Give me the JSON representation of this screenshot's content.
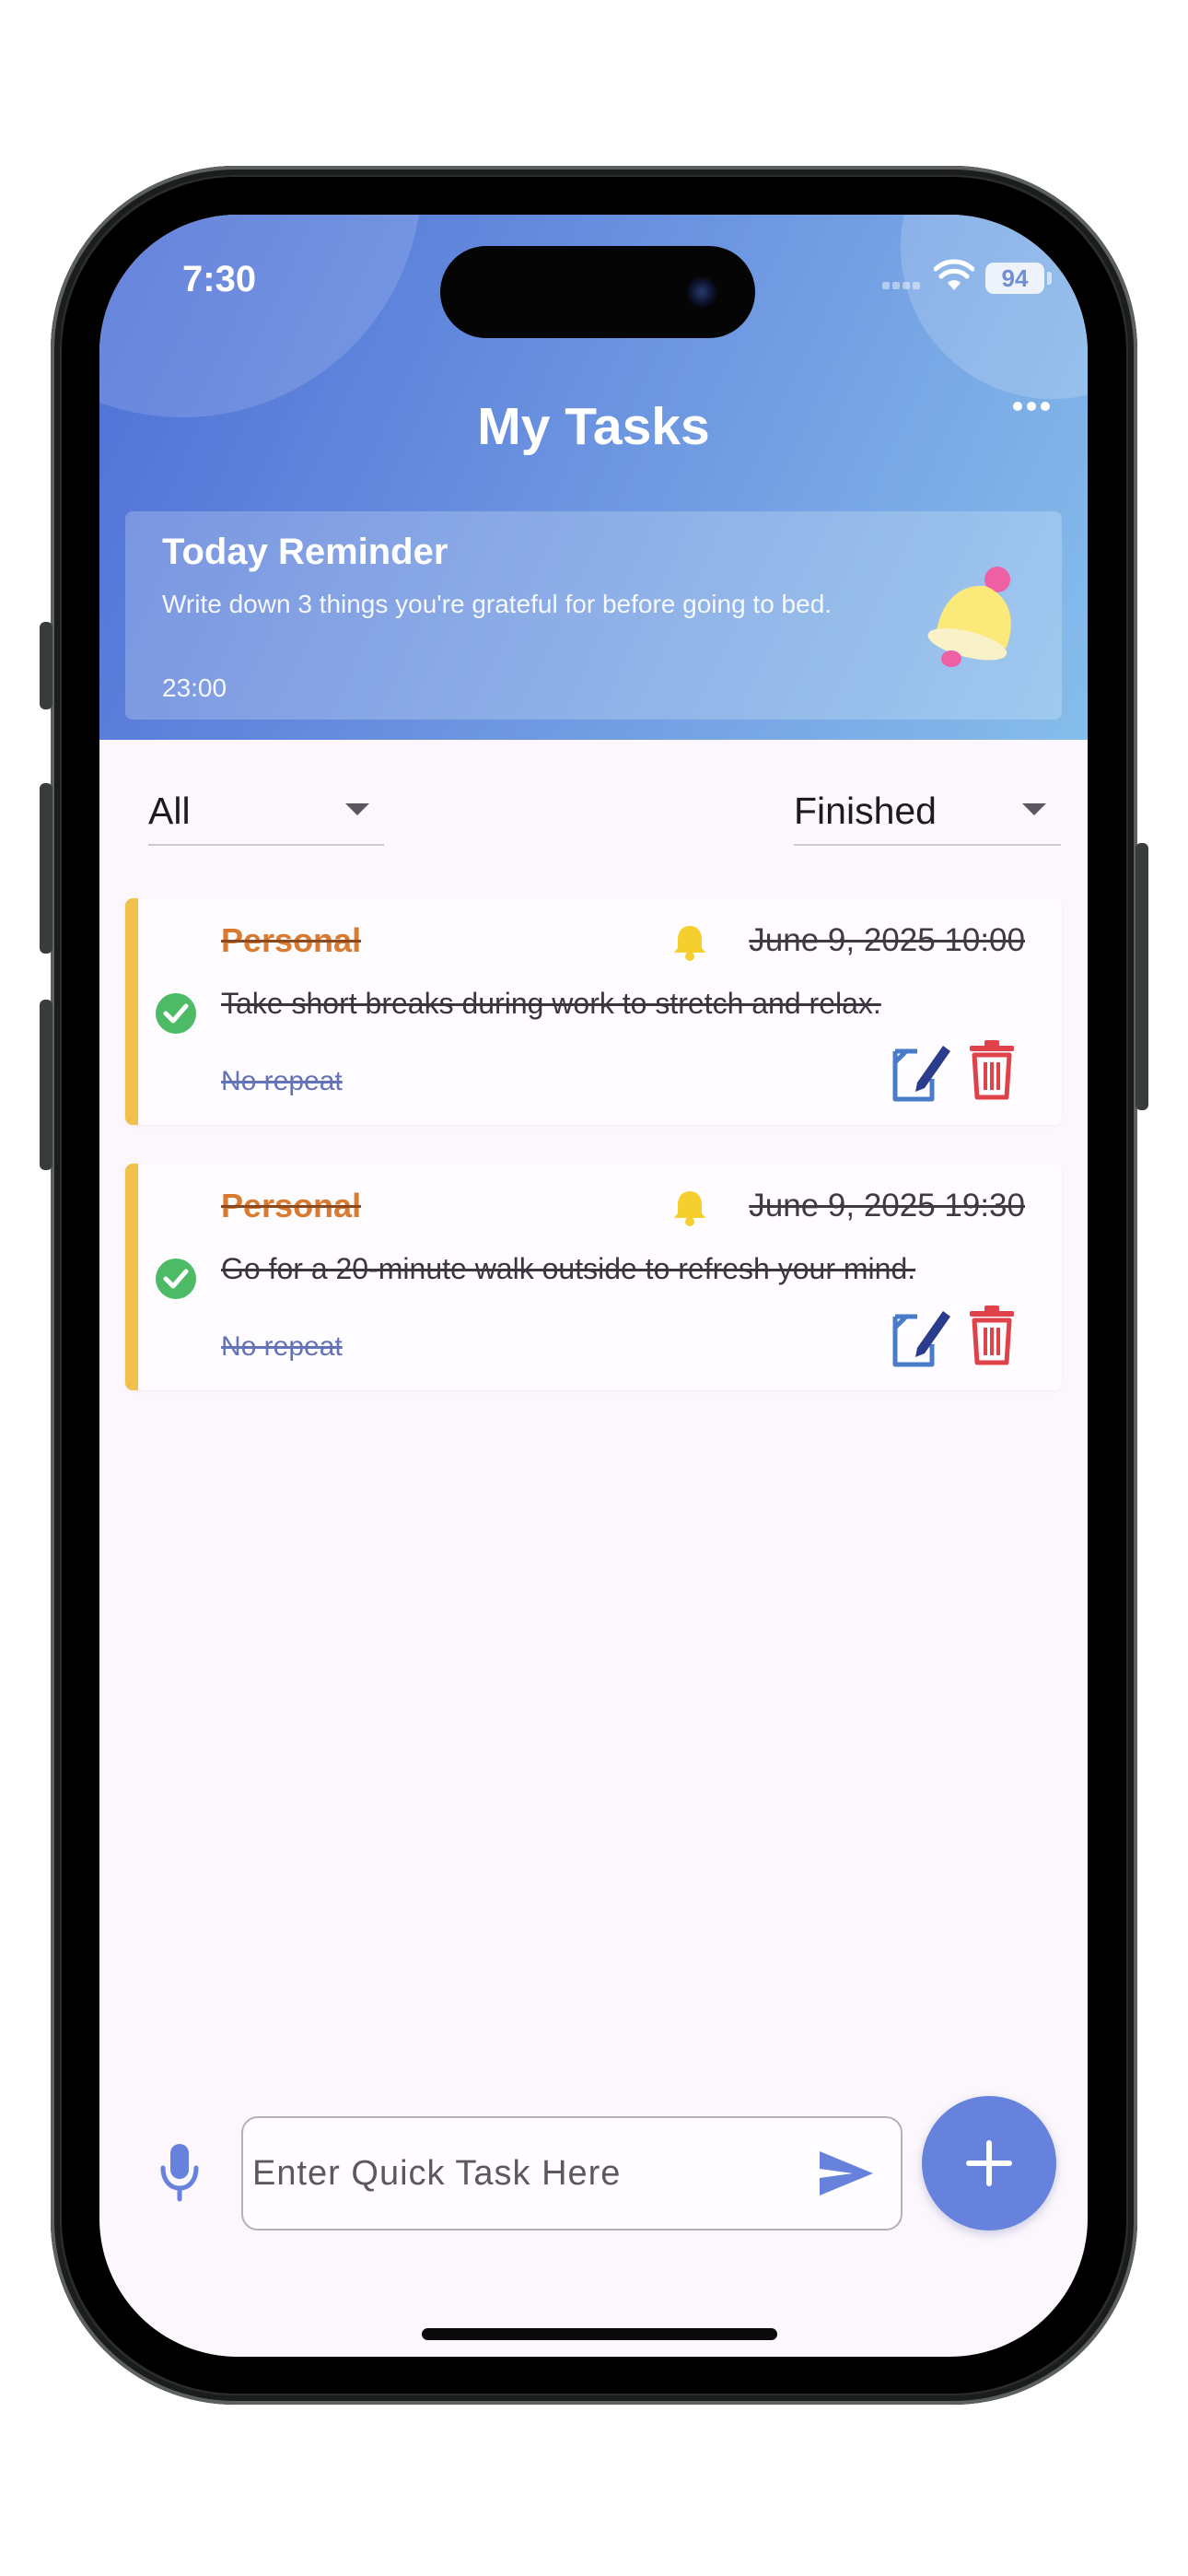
{
  "status_bar": {
    "time": "7:30",
    "battery": "94"
  },
  "header": {
    "title": "My Tasks",
    "menu_icon": "more-horizontal-icon",
    "gradient_colors": [
      "#4d6fd6",
      "#86bdeb"
    ]
  },
  "reminder": {
    "title": "Today Reminder",
    "text": "Write down 3 things you're grateful for before going to bed.",
    "time": "23:00",
    "icon": "bell-icon"
  },
  "filters": {
    "category": {
      "selected": "All"
    },
    "status": {
      "selected": "Finished"
    }
  },
  "tasks": [
    {
      "category": "Personal",
      "datetime": "June 9, 2025 10:00",
      "description": "Take short breaks during work to stretch and relax.",
      "repeat": "No repeat",
      "completed": true
    },
    {
      "category": "Personal",
      "datetime": "June 9, 2025 19:30",
      "description": "Go for a 20-minute walk outside to refresh your mind.",
      "repeat": "No repeat",
      "completed": true
    }
  ],
  "quick_task": {
    "placeholder": "Enter Quick Task Here",
    "value": ""
  },
  "colors": {
    "accent": "#6682dc",
    "category_text": "#d97a31",
    "card_accent": "#f1c24b",
    "done_green": "#4dbb65",
    "delete_red": "#e0424a"
  }
}
